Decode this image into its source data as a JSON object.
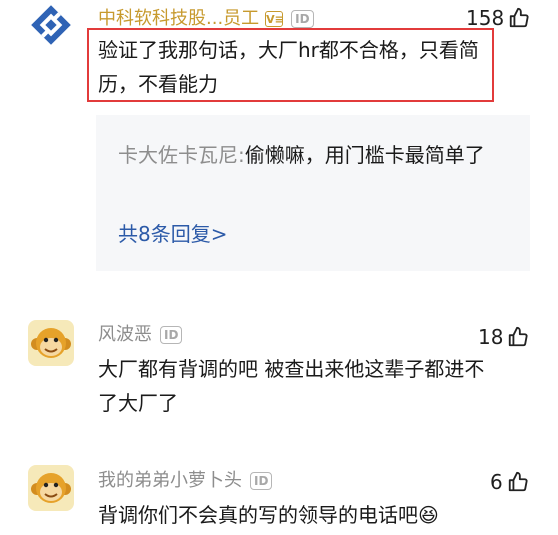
{
  "comments": [
    {
      "author": "中科软科技股...员工",
      "verified_badge": "V≡",
      "id_badge": "ID",
      "likes": "158",
      "text": "验证了我那句话，大厂hr都不合格，只看简历，不看能力",
      "reply": {
        "author": "卡大佐卡瓦尼:",
        "text": "偷懒嘛，用门槛卡最简单了",
        "more": "共8条回复>"
      }
    },
    {
      "author": "风波恶",
      "id_badge": "ID",
      "likes": "18",
      "text": "大厂都有背调的吧 被查出来他这辈子都进不了大厂了"
    },
    {
      "author": "我的弟弟小萝卜头",
      "id_badge": "ID",
      "likes": "6",
      "text": "背调你们不会真的写的领导的电话吧",
      "emoji": "😆"
    }
  ],
  "colors": {
    "highlight": "#e23b3b",
    "link": "#2c5aa8",
    "author_gold": "#c79a2e"
  }
}
